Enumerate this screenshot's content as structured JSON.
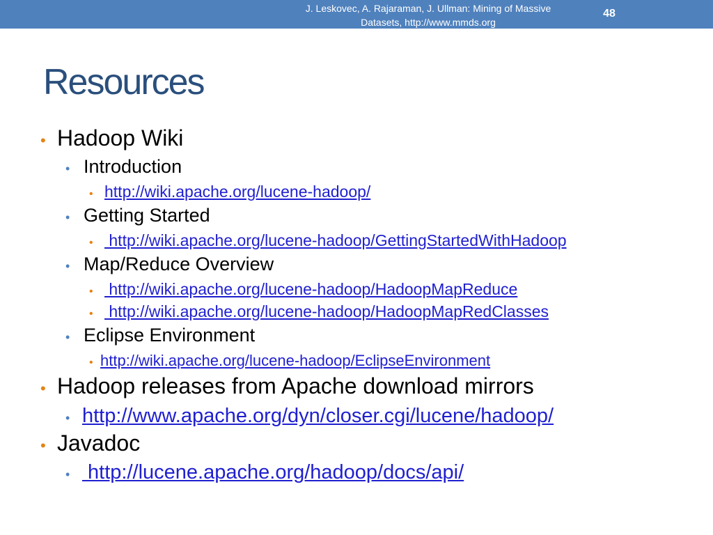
{
  "header": {
    "citation_line1": "J. Leskovec, A. Rajaraman, J. Ullman: Mining of Massive",
    "citation_line2": "Datasets, http://www.mmds.org",
    "page_number": "48"
  },
  "title": "Resources",
  "items": {
    "hadoop_wiki": "Hadoop Wiki",
    "introduction": "Introduction",
    "introduction_link": "http://wiki.apache.org/lucene-hadoop/",
    "getting_started": "Getting Started",
    "getting_started_link": " http://wiki.apache.org/lucene-hadoop/GettingStartedWithHadoop",
    "mapreduce_overview": "Map/Reduce Overview",
    "mapreduce_link1": " http://wiki.apache.org/lucene-hadoop/HadoopMapReduce",
    "mapreduce_link2": " http://wiki.apache.org/lucene-hadoop/HadoopMapRedClasses",
    "eclipse_env": "Eclipse Environment",
    "eclipse_link": "http://wiki.apache.org/lucene-hadoop/EclipseEnvironment",
    "releases": "Hadoop releases from Apache download mirrors",
    "releases_link": "http://www.apache.org/dyn/closer.cgi/lucene/hadoop/",
    "javadoc": "Javadoc",
    "javadoc_link": " http://lucene.apache.org/hadoop/docs/api/"
  }
}
